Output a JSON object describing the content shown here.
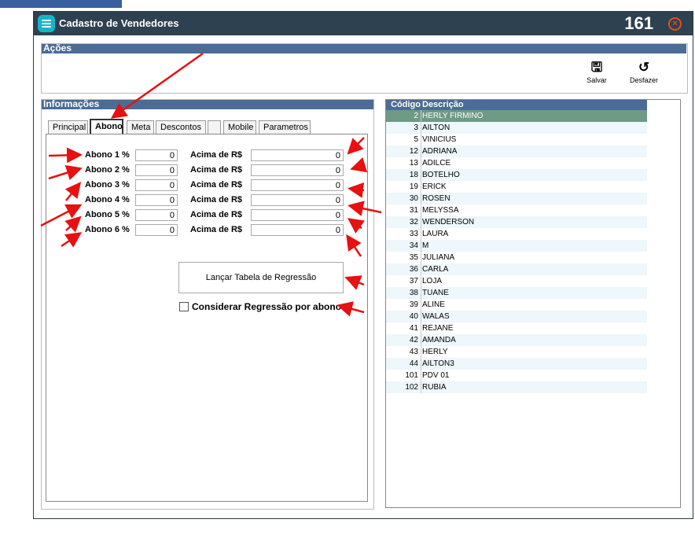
{
  "window": {
    "title": "Cadastro de Vendedores",
    "number": "161"
  },
  "acoes": {
    "header": "Ações",
    "save_label": "Salvar",
    "undo_label": "Desfazer"
  },
  "info": {
    "header": "Informações",
    "tabs": [
      "Principal",
      "Abono",
      "Meta",
      "Descontos",
      "",
      "Mobile",
      "Parametros"
    ],
    "active_tab": "Abono"
  },
  "abono": {
    "rows": [
      {
        "label": "Abono 1 %",
        "percent": "0",
        "acima_label": "Acima de R$",
        "acima": "0"
      },
      {
        "label": "Abono 2 %",
        "percent": "0",
        "acima_label": "Acima de R$",
        "acima": "0"
      },
      {
        "label": "Abono 3 %",
        "percent": "0",
        "acima_label": "Acima de R$",
        "acima": "0"
      },
      {
        "label": "Abono 4 %",
        "percent": "0",
        "acima_label": "Acima de R$",
        "acima": "0"
      },
      {
        "label": "Abono 5 %",
        "percent": "0",
        "acima_label": "Acima de R$",
        "acima": "0"
      },
      {
        "label": "Abono 6 %",
        "percent": "0",
        "acima_label": "Acima de R$",
        "acima": "0"
      }
    ],
    "lancar_button": "Lançar Tabela de Regressão",
    "considerar_label": "Considerar Regressão por abono"
  },
  "grid": {
    "columns": [
      "Código",
      "Descrição"
    ],
    "rows": [
      [
        "2",
        "HERLY  FIRMINO"
      ],
      [
        "3",
        "AILTON"
      ],
      [
        "5",
        "VINICIUS"
      ],
      [
        "12",
        "ADRIANA"
      ],
      [
        "13",
        "ADILCE"
      ],
      [
        "18",
        "BOTELHO"
      ],
      [
        "19",
        "ERICK"
      ],
      [
        "30",
        "ROSEN"
      ],
      [
        "31",
        "MELYSSA"
      ],
      [
        "32",
        "WENDERSON"
      ],
      [
        "33",
        "LAURA"
      ],
      [
        "34",
        "M"
      ],
      [
        "35",
        "JULIANA"
      ],
      [
        "36",
        "CARLA"
      ],
      [
        "37",
        "LOJA"
      ],
      [
        "38",
        "TUANE"
      ],
      [
        "39",
        "ALINE"
      ],
      [
        "40",
        "WALAS"
      ],
      [
        "41",
        "REJANE"
      ],
      [
        "42",
        "AMANDA"
      ],
      [
        "43",
        "HERLY"
      ],
      [
        "44",
        "AILTON3"
      ],
      [
        "101",
        "PDV 01"
      ],
      [
        "102",
        "RUBIA"
      ]
    ],
    "selected_index": 0
  },
  "colors": {
    "titlebar": "#2e4150",
    "section_header": "#4a6c95",
    "selected_row": "#6e9a86",
    "annotation_arrow": "#e81010"
  }
}
